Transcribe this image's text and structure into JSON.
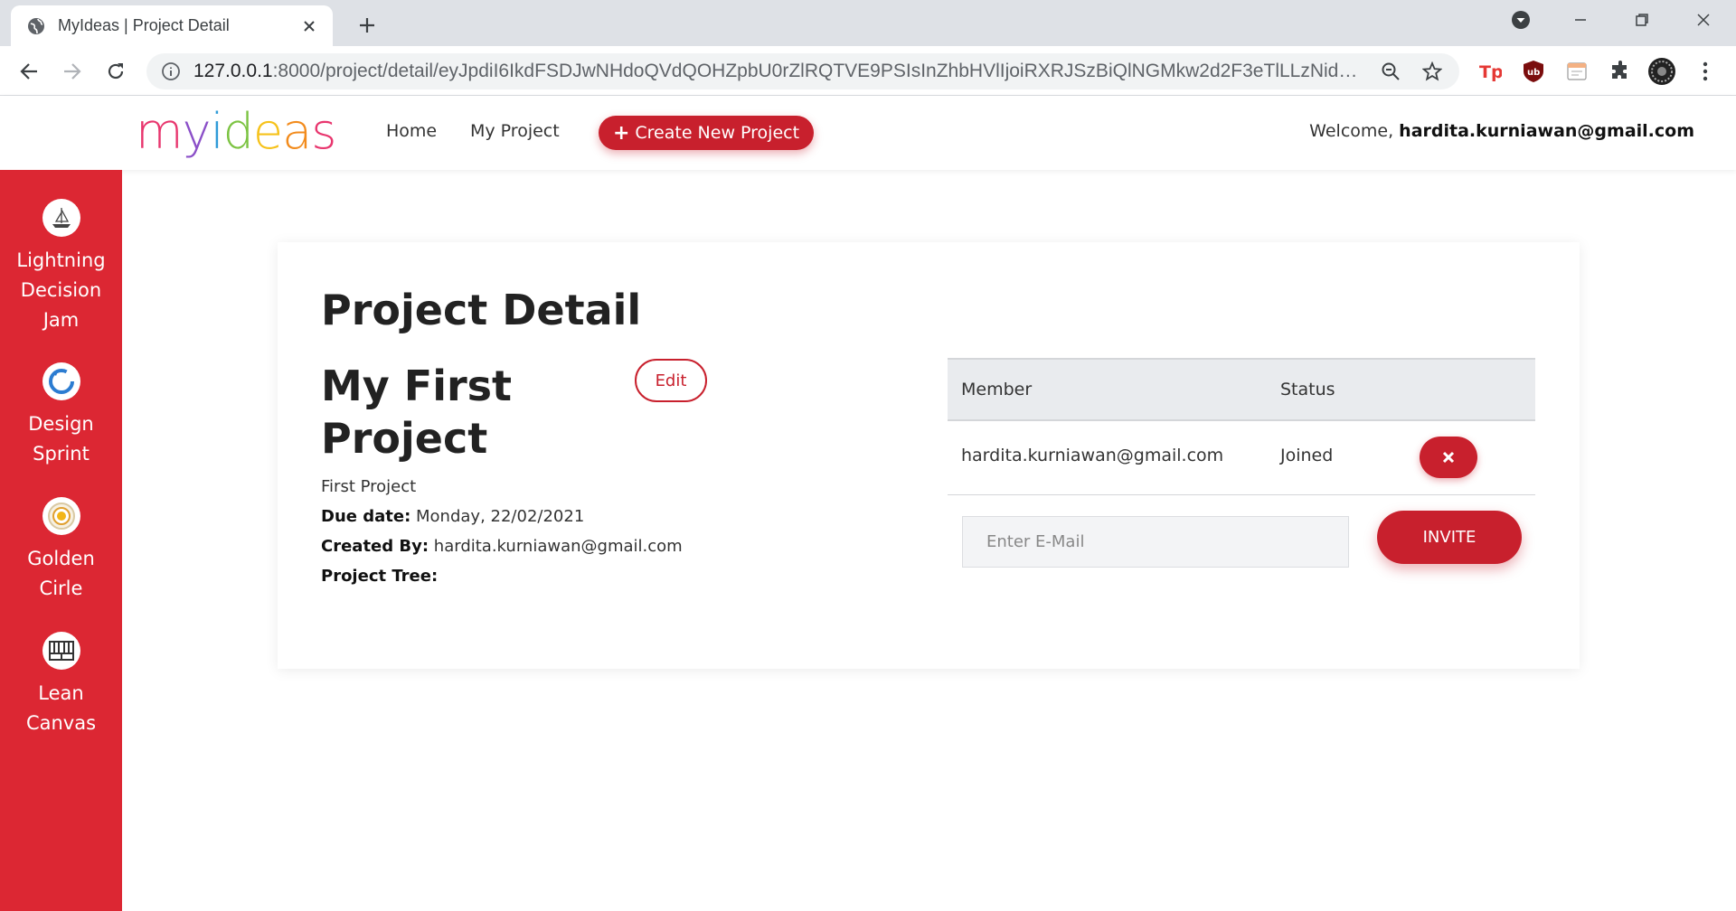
{
  "browser": {
    "tab_title": "MyIdeas | Project Detail",
    "url_host": "127.0.0.1",
    "url_rest": ":8000/project/detail/eyJpdiI6IkdFSDJwNHdoQVdQOHZpbU0rZlRQTVE9PSIsInZhbHVlIjoiRXRJSzBiQlNGMkw2d2F3eTlLLzNidz09Iiwi...",
    "icons": [
      "globe-icon",
      "close-icon",
      "plus-icon",
      "back-icon",
      "forward-icon",
      "reload-icon",
      "info-icon",
      "zoom-icon",
      "star-icon",
      "extensions-icon",
      "menu-icon"
    ]
  },
  "navbar": {
    "logo_letters": [
      {
        "ch": "m",
        "color": "#e8366e"
      },
      {
        "ch": "y",
        "color": "#8b4fc8"
      },
      {
        "ch": "i",
        "color": "#2f9bd8"
      },
      {
        "ch": "d",
        "color": "#7cc342"
      },
      {
        "ch": "e",
        "color": "#f6c21a"
      },
      {
        "ch": "a",
        "color": "#f28b1c"
      },
      {
        "ch": "s",
        "color": "#e8366e"
      }
    ],
    "home": "Home",
    "my_project": "My Project",
    "create_label": "Create New Project",
    "create_icon": "plus-icon",
    "welcome_prefix": "Welcome, ",
    "welcome_user": "hardita.kurniawan@gmail.com"
  },
  "sidebar": {
    "items": [
      {
        "label_lines": [
          "Lightning",
          "Decision",
          "Jam"
        ],
        "icon": "sailboat-icon"
      },
      {
        "label_lines": [
          "Design",
          "Sprint"
        ],
        "icon": "cycle-icon"
      },
      {
        "label_lines": [
          "Golden",
          "Cirle"
        ],
        "icon": "target-icon"
      },
      {
        "label_lines": [
          "Lean",
          "Canvas"
        ],
        "icon": "grid-icon"
      }
    ]
  },
  "project": {
    "page_title": "Project Detail",
    "name": "My First Project",
    "edit_label": "Edit",
    "description": "First Project",
    "due_label": "Due date:",
    "due_value": "Monday, 22/02/2021",
    "created_label": "Created By:",
    "created_value": "hardita.kurniawan@gmail.com",
    "tree_label": "Project Tree:"
  },
  "members": {
    "col_member": "Member",
    "col_status": "Status",
    "rows": [
      {
        "email": "hardita.kurniawan@gmail.com",
        "status": "Joined"
      }
    ],
    "email_placeholder": "Enter E-Mail",
    "invite_label": "INVITE"
  },
  "colors": {
    "brand_red": "#c8202d",
    "sidebar_red": "#dc2733"
  }
}
